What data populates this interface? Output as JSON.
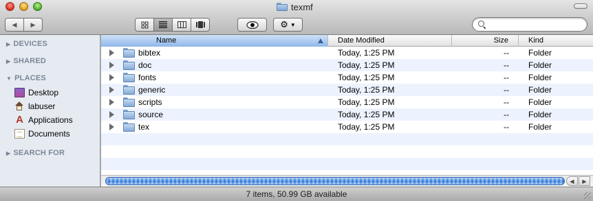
{
  "window": {
    "title": "texmf"
  },
  "toolbar": {
    "nav_back_icon": "back-arrow-icon",
    "nav_forward_icon": "forward-arrow-icon",
    "view_modes": [
      "icon-view",
      "list-view",
      "column-view",
      "coverflow-view"
    ],
    "active_view": "list-view",
    "search_placeholder": ""
  },
  "sidebar": {
    "sections": [
      {
        "label": "DEVICES",
        "expanded": false
      },
      {
        "label": "SHARED",
        "expanded": false
      },
      {
        "label": "PLACES",
        "expanded": true
      },
      {
        "label": "SEARCH FOR",
        "expanded": false
      }
    ],
    "places": [
      {
        "label": "Desktop",
        "icon": "desktop-icon"
      },
      {
        "label": "labuser",
        "icon": "home-icon"
      },
      {
        "label": "Applications",
        "icon": "applications-icon"
      },
      {
        "label": "Documents",
        "icon": "documents-icon"
      }
    ]
  },
  "columns": {
    "name": "Name",
    "date": "Date Modified",
    "size": "Size",
    "kind": "Kind"
  },
  "files": [
    {
      "name": "bibtex",
      "date": "Today, 1:25 PM",
      "size": "--",
      "kind": "Folder"
    },
    {
      "name": "doc",
      "date": "Today, 1:25 PM",
      "size": "--",
      "kind": "Folder"
    },
    {
      "name": "fonts",
      "date": "Today, 1:25 PM",
      "size": "--",
      "kind": "Folder"
    },
    {
      "name": "generic",
      "date": "Today, 1:25 PM",
      "size": "--",
      "kind": "Folder"
    },
    {
      "name": "scripts",
      "date": "Today, 1:25 PM",
      "size": "--",
      "kind": "Folder"
    },
    {
      "name": "source",
      "date": "Today, 1:25 PM",
      "size": "--",
      "kind": "Folder"
    },
    {
      "name": "tex",
      "date": "Today, 1:25 PM",
      "size": "--",
      "kind": "Folder"
    }
  ],
  "status": {
    "text": "7 items, 50.99 GB available"
  },
  "colors": {
    "sidebar_bg": "#e6ebf2",
    "row_alt": "#edf3fe",
    "selected_header": "#8fb7ea"
  }
}
